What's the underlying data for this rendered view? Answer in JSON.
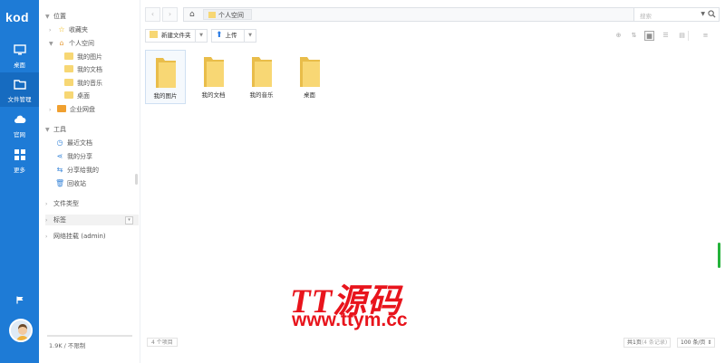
{
  "app": {
    "logo": "kod"
  },
  "appbar": {
    "items": [
      {
        "label": "桌面",
        "icon": "monitor-icon"
      },
      {
        "label": "文件管理",
        "icon": "folder-icon"
      },
      {
        "label": "官网",
        "icon": "cloud-icon"
      },
      {
        "label": "更多",
        "icon": "grid-icon"
      }
    ]
  },
  "tree": {
    "location": "位置",
    "favorites": "收藏夹",
    "personal": "个人空间",
    "pictures": "我的图片",
    "documents": "我的文档",
    "music": "我的音乐",
    "desktop": "桌面",
    "enterprise": "企业网盘",
    "tools": "工具",
    "recent": "最近文档",
    "my_share": "我的分享",
    "shared_to_me": "分享给我的",
    "recycle": "回收站",
    "file_types": "文件类型",
    "tags": "标签",
    "network_mount": "网络挂载 (admin)",
    "quota": "1.9K / 不限制"
  },
  "address": {
    "crumb": "个人空间"
  },
  "search": {
    "placeholder": "搜索"
  },
  "toolbar": {
    "new_folder": "新建文件夹",
    "upload": "上传"
  },
  "files": [
    {
      "name": "我的图片"
    },
    {
      "name": "我的文档"
    },
    {
      "name": "我的音乐"
    },
    {
      "name": "桌面"
    }
  ],
  "status": {
    "count": "4 个项目",
    "page_prefix": "共1页",
    "page_records": "(4 条记录)",
    "per_page": "100 条/页"
  },
  "watermark": {
    "line1": "TT源码",
    "line2": "www.ttym.cc"
  },
  "colors": {
    "appbar": "#1e7bd6",
    "folder": "#f7d774",
    "accent": "#2a7be4",
    "watermark": "#e8141c",
    "scroll_indicator": "#24b23a"
  }
}
